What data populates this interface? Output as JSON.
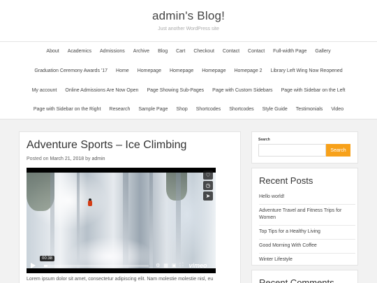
{
  "header": {
    "site_title": "admin's Blog!",
    "tagline": "Just another WordPress site"
  },
  "nav": {
    "rows": [
      [
        "About",
        "Academics",
        "Admissions",
        "Archive",
        "Blog",
        "Cart",
        "Checkout",
        "Contact",
        "Contact",
        "Full-width Page",
        "Gallery"
      ],
      [
        "Graduation Ceremony Awards '17",
        "Home",
        "Homepage",
        "Homepage",
        "Homepage",
        "Homepage 2",
        "Library Left Wing Now Reopened"
      ],
      [
        "My account",
        "Online Admissions Are Now Open",
        "Page Showing Sub-Pages",
        "Page with Custom Sidebars",
        "Page with Sidebar on the Left"
      ],
      [
        "Page with Sidebar on the Right",
        "Research",
        "Sample Page",
        "Shop",
        "Shortcodes",
        "Shortcodes",
        "Style Guide",
        "Testimonials",
        "Video"
      ]
    ]
  },
  "post": {
    "title": "Adventure Sports – Ice Climbing",
    "meta_prefix": "Posted on",
    "date": "March 21, 2018",
    "meta_by": "by",
    "author": "admin",
    "excerpt": "Lorem ipsum dolor sit amet, consectetur adipiscing elit. Nam molestie molestie nisl, eu"
  },
  "video": {
    "time": "00:38",
    "progress": 0.03,
    "brand": "vimeo",
    "side_icons": [
      "heart-icon",
      "clock-icon",
      "share-icon"
    ],
    "controls": [
      "play-icon",
      "settings-icon",
      "captions-icon",
      "pip-icon",
      "fullscreen-icon"
    ]
  },
  "sidebar": {
    "search_label": "Search",
    "search_placeholder": "",
    "search_button": "Search",
    "recent_posts_title": "Recent Posts",
    "recent_posts": [
      "Hello world!",
      "Adventure Travel and Fitness Trips for Women",
      "Top Tips for a Healthy Living",
      "Good Morning With Coffee",
      "Winter Lifestyle"
    ],
    "recent_comments_title": "Recent Comments"
  },
  "colors": {
    "accent": "#f7a11a",
    "background": "#f2f2f2"
  }
}
